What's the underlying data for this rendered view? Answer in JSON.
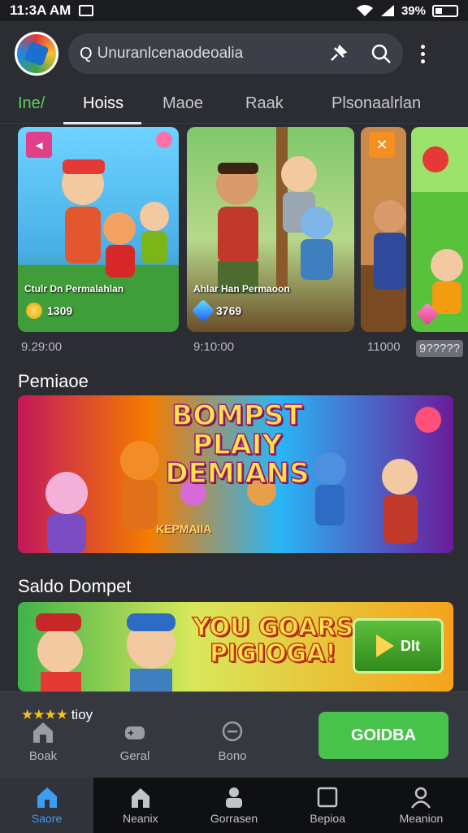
{
  "status_bar": {
    "time": "11:3A AM",
    "battery": "39%"
  },
  "search": {
    "prefix": "Q",
    "text": "Unuranlcenaodeoalia"
  },
  "tabs": [
    {
      "label": "Ine/"
    },
    {
      "label": "Hoiss"
    },
    {
      "label": "Maoe"
    },
    {
      "label": "Raak"
    },
    {
      "label": "Plsonaalrlan"
    }
  ],
  "cards": [
    {
      "title": "Ctulr Dn Permalahlan",
      "stat": "1309",
      "date": "9.29:00"
    },
    {
      "title": "Ahlar Han Permaoon",
      "stat": "3769",
      "date": "9:10:00"
    },
    {
      "title": "",
      "stat": "",
      "date": "11000"
    },
    {
      "title": "",
      "stat": "",
      "date": "9?????"
    }
  ],
  "sections": {
    "promo_title": "Pemiaoe",
    "saldo_title": "Saldo Dompet"
  },
  "banner1": {
    "headline_1": "BOMPST PLAIY",
    "headline_2": "DEMIANS",
    "sub": "KEPMAIIA"
  },
  "banner2": {
    "headline_1": "YOU GOARS",
    "headline_2": "PIGIOGA!",
    "button": "DIt"
  },
  "sheet": {
    "stars": "★★★★",
    "rating_text": "tioy",
    "cta": "GOIDBA",
    "items": [
      {
        "label": "Boak"
      },
      {
        "label": "Geral"
      },
      {
        "label": "Bono"
      }
    ]
  },
  "bottom_nav": [
    {
      "label": "Saore"
    },
    {
      "label": "Neanix"
    },
    {
      "label": "Gorrasen"
    },
    {
      "label": "Bepioa"
    },
    {
      "label": "Meanion"
    }
  ],
  "colors": {
    "accent_green": "#47c24b",
    "active_blue": "#3d9df2",
    "background": "#2b2d33"
  }
}
